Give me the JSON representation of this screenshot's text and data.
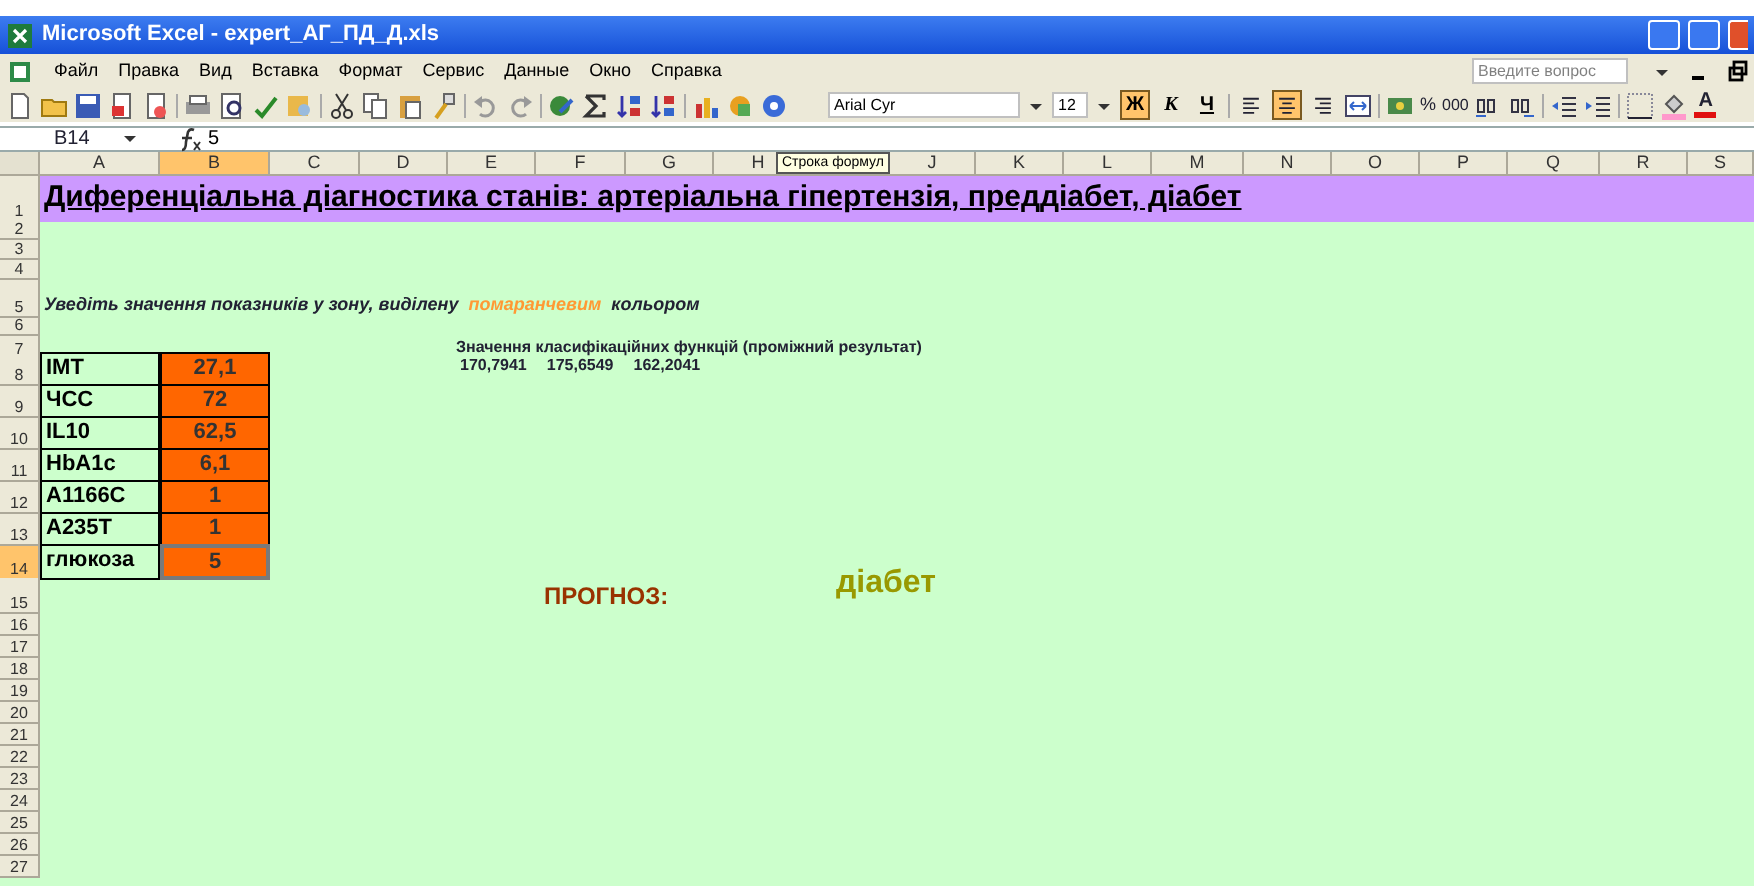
{
  "window": {
    "title": "Microsoft Excel - expert_АГ_ПД_Д.xls"
  },
  "menu": [
    {
      "label": "Файл"
    },
    {
      "label": "Правка"
    },
    {
      "label": "Вид"
    },
    {
      "label": "Вставка"
    },
    {
      "label": "Формат"
    },
    {
      "label": "Сервис"
    },
    {
      "label": "Данные"
    },
    {
      "label": "Окно"
    },
    {
      "label": "Справка"
    }
  ],
  "help_search": {
    "placeholder": "Введите вопрос"
  },
  "format_toolbar": {
    "font": "Arial Cyr",
    "size": "12",
    "style_buttons": [
      {
        "label": "Ж",
        "selected": true
      },
      {
        "label": "К",
        "selected": false
      },
      {
        "label": "Ч",
        "selected": false
      }
    ],
    "align_buttons": [
      {
        "selected": false
      },
      {
        "selected": true
      },
      {
        "selected": false
      }
    ],
    "percent": "%",
    "thousands": "000",
    "font_color_letter": "A"
  },
  "formula_bar": {
    "name_box": "B14",
    "value": "5",
    "tooltip": "Строка формул"
  },
  "columns": [
    {
      "label": "A",
      "selected": false
    },
    {
      "label": "B",
      "selected": true
    },
    {
      "label": "C",
      "selected": false
    },
    {
      "label": "D",
      "selected": false
    },
    {
      "label": "E",
      "selected": false
    },
    {
      "label": "F",
      "selected": false
    },
    {
      "label": "G",
      "selected": false
    },
    {
      "label": "H",
      "selected": false
    },
    {
      "label": "J",
      "selected": false
    },
    {
      "label": "K",
      "selected": false
    },
    {
      "label": "L",
      "selected": false
    },
    {
      "label": "M",
      "selected": false
    },
    {
      "label": "N",
      "selected": false
    },
    {
      "label": "O",
      "selected": false
    },
    {
      "label": "P",
      "selected": false
    },
    {
      "label": "Q",
      "selected": false
    },
    {
      "label": "R",
      "selected": false
    },
    {
      "label": "S",
      "selected": false
    }
  ],
  "row_numbers": [
    {
      "label": "1",
      "selected": false
    },
    {
      "label": "2",
      "selected": false
    },
    {
      "label": "3",
      "selected": false
    },
    {
      "label": "4",
      "selected": false
    },
    {
      "label": "5",
      "selected": false
    },
    {
      "label": "6",
      "selected": false
    },
    {
      "label": "7",
      "selected": false
    },
    {
      "label": "8",
      "selected": false
    },
    {
      "label": "9",
      "selected": false
    },
    {
      "label": "10",
      "selected": false
    },
    {
      "label": "11",
      "selected": false
    },
    {
      "label": "12",
      "selected": false
    },
    {
      "label": "13",
      "selected": false
    },
    {
      "label": "14",
      "selected": true
    },
    {
      "label": "15",
      "selected": false
    },
    {
      "label": "16",
      "selected": false
    },
    {
      "label": "17",
      "selected": false
    },
    {
      "label": "18",
      "selected": false
    },
    {
      "label": "19",
      "selected": false
    },
    {
      "label": "20",
      "selected": false
    },
    {
      "label": "21",
      "selected": false
    },
    {
      "label": "22",
      "selected": false
    },
    {
      "label": "23",
      "selected": false
    },
    {
      "label": "24",
      "selected": false
    },
    {
      "label": "25",
      "selected": false
    },
    {
      "label": "26",
      "selected": false
    },
    {
      "label": "27",
      "selected": false
    }
  ],
  "sheet": {
    "title": "Диференціальна діагностика станів: артеріальна гіпертензія, преддіабет, діабет",
    "instruction": [
      {
        "text": "Уведіть значення показників у зону, виділену",
        "kind": "plain"
      },
      {
        "text": "помаранчевим",
        "kind": "highlight"
      },
      {
        "text": "кольором",
        "kind": "plain"
      }
    ],
    "functions_label": "Значення класифікаційних функцій (проміжний результат)",
    "function_values": [
      "170,7941",
      "175,6549",
      "162,2041"
    ],
    "inputs": [
      {
        "label": "IMT",
        "value": "27,1",
        "selected": false
      },
      {
        "label": "ЧСС",
        "value": "72",
        "selected": false
      },
      {
        "label": "IL10",
        "value": "62,5",
        "selected": false
      },
      {
        "label": "HbA1c",
        "value": "6,1",
        "selected": false
      },
      {
        "label": "A1166C",
        "value": "1",
        "selected": false
      },
      {
        "label": "A235T",
        "value": "1",
        "selected": false
      },
      {
        "label": "глюкоза",
        "value": "5",
        "selected": true
      }
    ],
    "prognosis_label": "ПРОГНОЗ:",
    "prognosis": "діабет"
  }
}
